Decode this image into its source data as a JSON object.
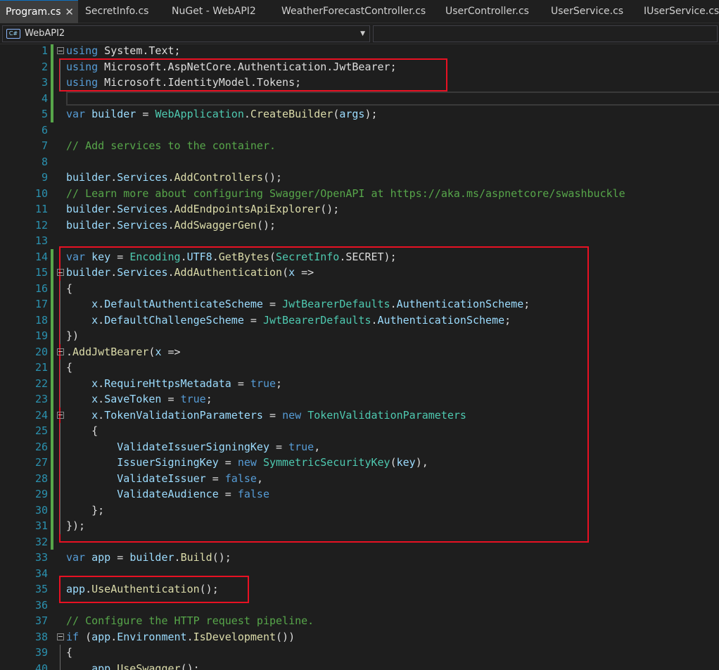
{
  "tabs": [
    {
      "label": "Program.cs",
      "active": true
    },
    {
      "label": "SecretInfo.cs",
      "active": false
    },
    {
      "label": "NuGet - WebAPI2",
      "active": false
    },
    {
      "label": "WeatherForecastController.cs",
      "active": false
    },
    {
      "label": "UserController.cs",
      "active": false
    },
    {
      "label": "UserService.cs",
      "active": false
    },
    {
      "label": "IUserService.cs",
      "active": false
    }
  ],
  "close_glyph": "✕",
  "navbar": {
    "language_badge": "C#",
    "language_icon": "csharp-project-icon",
    "project": "WebAPI2",
    "dropdown_icon": "chevron-down-icon",
    "member": ""
  },
  "colors": {
    "keyword": "#569cd6",
    "type": "#4ec9b0",
    "method": "#dcdcaa",
    "variable": "#9cdcfe",
    "comment": "#57a64a",
    "line_number": "#2b91af",
    "highlight_box": "#e81123",
    "active_tab_accent": "#0e70c0"
  },
  "editor": {
    "lines": [
      {
        "n": 1,
        "tokens": [
          [
            "kw",
            "using"
          ],
          [
            "pl",
            " System.Text;"
          ]
        ]
      },
      {
        "n": 2,
        "tokens": [
          [
            "kw",
            "using"
          ],
          [
            "pl",
            " Microsoft.AspNetCore.Authentication.JwtBearer;"
          ]
        ]
      },
      {
        "n": 3,
        "tokens": [
          [
            "kw",
            "using"
          ],
          [
            "pl",
            " Microsoft.IdentityModel.Tokens;"
          ]
        ]
      },
      {
        "n": 4,
        "tokens": []
      },
      {
        "n": 5,
        "tokens": [
          [
            "kw",
            "var"
          ],
          [
            "pl",
            " "
          ],
          [
            "va",
            "builder"
          ],
          [
            "pl",
            " = "
          ],
          [
            "ty",
            "WebApplication"
          ],
          [
            "pl",
            "."
          ],
          [
            "mt",
            "CreateBuilder"
          ],
          [
            "pl",
            "("
          ],
          [
            "va",
            "args"
          ],
          [
            "pl",
            ");"
          ]
        ]
      },
      {
        "n": 6,
        "tokens": []
      },
      {
        "n": 7,
        "tokens": [
          [
            "cm",
            "// Add services to the container."
          ]
        ]
      },
      {
        "n": 8,
        "tokens": []
      },
      {
        "n": 9,
        "tokens": [
          [
            "va",
            "builder"
          ],
          [
            "pl",
            "."
          ],
          [
            "va",
            "Services"
          ],
          [
            "pl",
            "."
          ],
          [
            "mt",
            "AddControllers"
          ],
          [
            "pl",
            "();"
          ]
        ]
      },
      {
        "n": 10,
        "tokens": [
          [
            "cm",
            "// Learn more about configuring Swagger/OpenAPI at https://aka.ms/aspnetcore/swashbuckle"
          ]
        ]
      },
      {
        "n": 11,
        "tokens": [
          [
            "va",
            "builder"
          ],
          [
            "pl",
            "."
          ],
          [
            "va",
            "Services"
          ],
          [
            "pl",
            "."
          ],
          [
            "mt",
            "AddEndpointsApiExplorer"
          ],
          [
            "pl",
            "();"
          ]
        ]
      },
      {
        "n": 12,
        "tokens": [
          [
            "va",
            "builder"
          ],
          [
            "pl",
            "."
          ],
          [
            "va",
            "Services"
          ],
          [
            "pl",
            "."
          ],
          [
            "mt",
            "AddSwaggerGen"
          ],
          [
            "pl",
            "();"
          ]
        ]
      },
      {
        "n": 13,
        "tokens": []
      },
      {
        "n": 14,
        "tokens": [
          [
            "kw",
            "var"
          ],
          [
            "pl",
            " "
          ],
          [
            "va",
            "key"
          ],
          [
            "pl",
            " = "
          ],
          [
            "ty",
            "Encoding"
          ],
          [
            "pl",
            "."
          ],
          [
            "va",
            "UTF8"
          ],
          [
            "pl",
            "."
          ],
          [
            "mt",
            "GetBytes"
          ],
          [
            "pl",
            "("
          ],
          [
            "ty",
            "SecretInfo"
          ],
          [
            "pl",
            ".SECRET);"
          ]
        ]
      },
      {
        "n": 15,
        "tokens": [
          [
            "va",
            "builder"
          ],
          [
            "pl",
            "."
          ],
          [
            "va",
            "Services"
          ],
          [
            "pl",
            "."
          ],
          [
            "mt",
            "AddAuthentication"
          ],
          [
            "pl",
            "("
          ],
          [
            "va",
            "x"
          ],
          [
            "pl",
            " =>"
          ]
        ]
      },
      {
        "n": 16,
        "tokens": [
          [
            "pl",
            "{"
          ]
        ]
      },
      {
        "n": 17,
        "tokens": [
          [
            "pl",
            "    "
          ],
          [
            "va",
            "x"
          ],
          [
            "pl",
            "."
          ],
          [
            "va",
            "DefaultAuthenticateScheme"
          ],
          [
            "pl",
            " = "
          ],
          [
            "ty",
            "JwtBearerDefaults"
          ],
          [
            "pl",
            "."
          ],
          [
            "va",
            "AuthenticationScheme"
          ],
          [
            "pl",
            ";"
          ]
        ]
      },
      {
        "n": 18,
        "tokens": [
          [
            "pl",
            "    "
          ],
          [
            "va",
            "x"
          ],
          [
            "pl",
            "."
          ],
          [
            "va",
            "DefaultChallengeScheme"
          ],
          [
            "pl",
            " = "
          ],
          [
            "ty",
            "JwtBearerDefaults"
          ],
          [
            "pl",
            "."
          ],
          [
            "va",
            "AuthenticationScheme"
          ],
          [
            "pl",
            ";"
          ]
        ]
      },
      {
        "n": 19,
        "tokens": [
          [
            "pl",
            "})"
          ]
        ]
      },
      {
        "n": 20,
        "tokens": [
          [
            "pl",
            "."
          ],
          [
            "mt",
            "AddJwtBearer"
          ],
          [
            "pl",
            "("
          ],
          [
            "va",
            "x"
          ],
          [
            "pl",
            " =>"
          ]
        ]
      },
      {
        "n": 21,
        "tokens": [
          [
            "pl",
            "{"
          ]
        ]
      },
      {
        "n": 22,
        "tokens": [
          [
            "pl",
            "    "
          ],
          [
            "va",
            "x"
          ],
          [
            "pl",
            "."
          ],
          [
            "va",
            "RequireHttpsMetadata"
          ],
          [
            "pl",
            " = "
          ],
          [
            "kw",
            "true"
          ],
          [
            "pl",
            ";"
          ]
        ]
      },
      {
        "n": 23,
        "tokens": [
          [
            "pl",
            "    "
          ],
          [
            "va",
            "x"
          ],
          [
            "pl",
            "."
          ],
          [
            "va",
            "SaveToken"
          ],
          [
            "pl",
            " = "
          ],
          [
            "kw",
            "true"
          ],
          [
            "pl",
            ";"
          ]
        ]
      },
      {
        "n": 24,
        "tokens": [
          [
            "pl",
            "    "
          ],
          [
            "va",
            "x"
          ],
          [
            "pl",
            "."
          ],
          [
            "va",
            "TokenValidationParameters"
          ],
          [
            "pl",
            " = "
          ],
          [
            "kw",
            "new"
          ],
          [
            "pl",
            " "
          ],
          [
            "ty",
            "TokenValidationParameters"
          ]
        ]
      },
      {
        "n": 25,
        "tokens": [
          [
            "pl",
            "    {"
          ]
        ]
      },
      {
        "n": 26,
        "tokens": [
          [
            "pl",
            "        "
          ],
          [
            "va",
            "ValidateIssuerSigningKey"
          ],
          [
            "pl",
            " = "
          ],
          [
            "kw",
            "true"
          ],
          [
            "pl",
            ","
          ]
        ]
      },
      {
        "n": 27,
        "tokens": [
          [
            "pl",
            "        "
          ],
          [
            "va",
            "IssuerSigningKey"
          ],
          [
            "pl",
            " = "
          ],
          [
            "kw",
            "new"
          ],
          [
            "pl",
            " "
          ],
          [
            "ty",
            "SymmetricSecurityKey"
          ],
          [
            "pl",
            "("
          ],
          [
            "va",
            "key"
          ],
          [
            "pl",
            "),"
          ]
        ]
      },
      {
        "n": 28,
        "tokens": [
          [
            "pl",
            "        "
          ],
          [
            "va",
            "ValidateIssuer"
          ],
          [
            "pl",
            " = "
          ],
          [
            "kw",
            "false"
          ],
          [
            "pl",
            ","
          ]
        ]
      },
      {
        "n": 29,
        "tokens": [
          [
            "pl",
            "        "
          ],
          [
            "va",
            "ValidateAudience"
          ],
          [
            "pl",
            " = "
          ],
          [
            "kw",
            "false"
          ]
        ]
      },
      {
        "n": 30,
        "tokens": [
          [
            "pl",
            "    };"
          ]
        ]
      },
      {
        "n": 31,
        "tokens": [
          [
            "pl",
            "});"
          ]
        ]
      },
      {
        "n": 32,
        "tokens": []
      },
      {
        "n": 33,
        "tokens": [
          [
            "kw",
            "var"
          ],
          [
            "pl",
            " "
          ],
          [
            "va",
            "app"
          ],
          [
            "pl",
            " = "
          ],
          [
            "va",
            "builder"
          ],
          [
            "pl",
            "."
          ],
          [
            "mt",
            "Build"
          ],
          [
            "pl",
            "();"
          ]
        ]
      },
      {
        "n": 34,
        "tokens": []
      },
      {
        "n": 35,
        "tokens": [
          [
            "va",
            "app"
          ],
          [
            "pl",
            "."
          ],
          [
            "mt",
            "UseAuthentication"
          ],
          [
            "pl",
            "();"
          ]
        ]
      },
      {
        "n": 36,
        "tokens": []
      },
      {
        "n": 37,
        "tokens": [
          [
            "cm",
            "// Configure the HTTP request pipeline."
          ]
        ]
      },
      {
        "n": 38,
        "tokens": [
          [
            "kw",
            "if"
          ],
          [
            "pl",
            " ("
          ],
          [
            "va",
            "app"
          ],
          [
            "pl",
            "."
          ],
          [
            "va",
            "Environment"
          ],
          [
            "pl",
            "."
          ],
          [
            "mt",
            "IsDevelopment"
          ],
          [
            "pl",
            "())"
          ]
        ]
      },
      {
        "n": 39,
        "tokens": [
          [
            "pl",
            "{"
          ]
        ]
      },
      {
        "n": 40,
        "tokens": [
          [
            "pl",
            "    "
          ],
          [
            "va",
            "app"
          ],
          [
            "pl",
            "."
          ],
          [
            "mt",
            "UseSwagger"
          ],
          [
            "pl",
            "();"
          ]
        ]
      }
    ],
    "fold_lines": [
      1,
      15,
      20,
      24,
      38
    ],
    "guide_lines": [
      2,
      3,
      16,
      17,
      18,
      19,
      21,
      22,
      23,
      25,
      26,
      27,
      28,
      29,
      30,
      31,
      39,
      40
    ],
    "caret_line": 4,
    "changed_ranges": [
      [
        1,
        5
      ],
      [
        14,
        32
      ]
    ]
  }
}
